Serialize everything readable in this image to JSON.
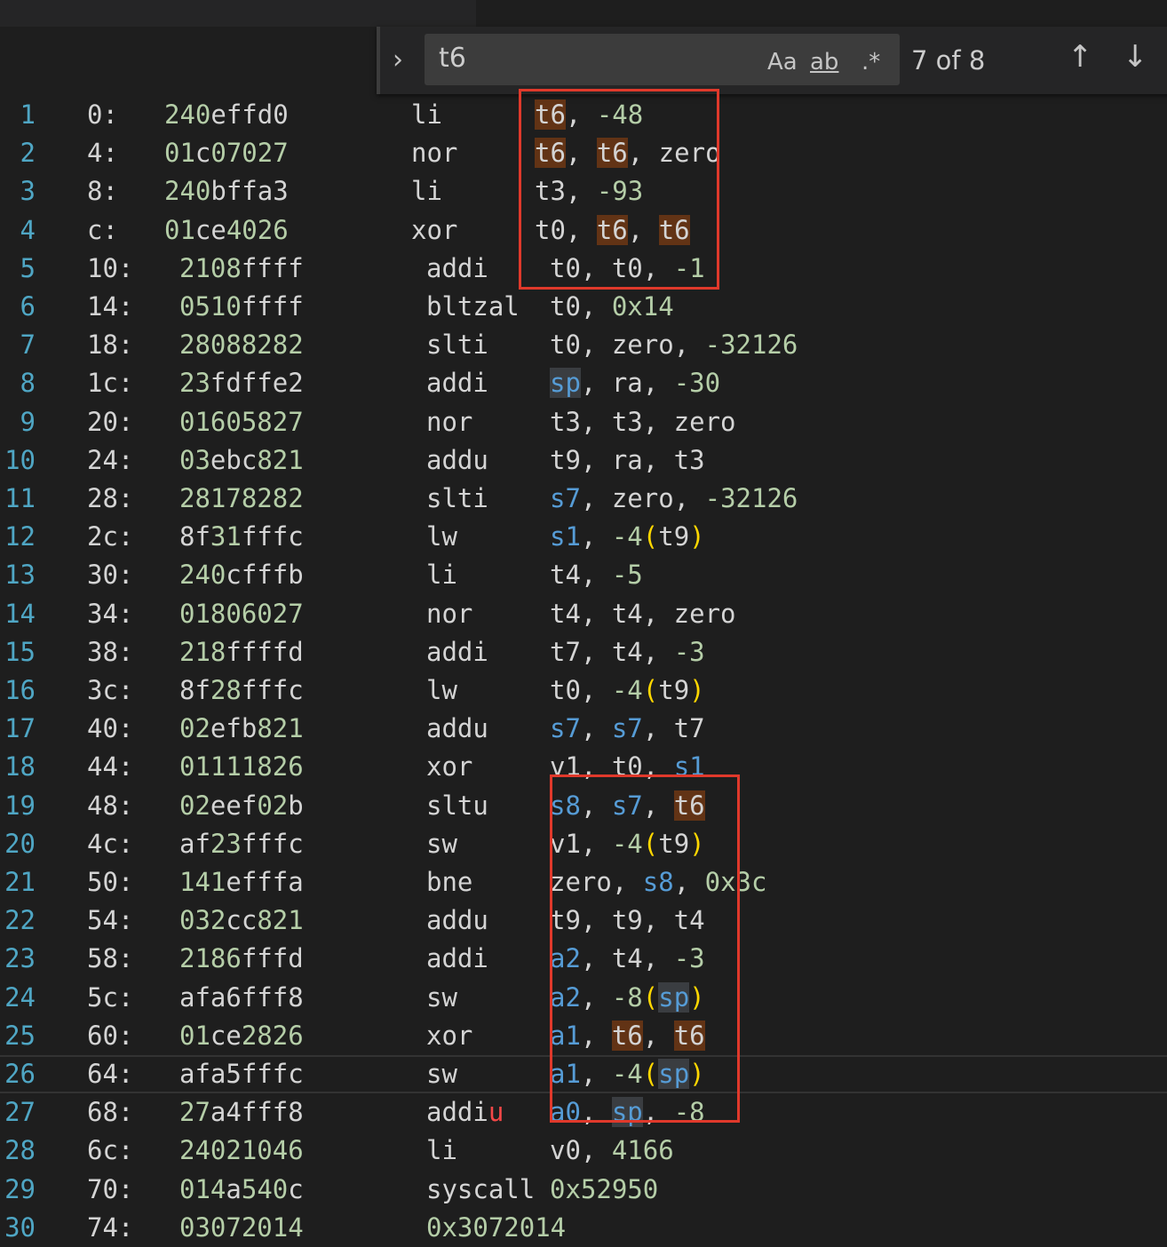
{
  "find": {
    "query": "t6",
    "match_case_label": "Aa",
    "whole_word_label": "ab",
    "regex_label": ".*",
    "result_count": "7 of 8"
  },
  "rows": [
    {
      "ln": "1",
      "off": "0:",
      "hex": "240effd0",
      "mn": "li",
      "ops": "t6, -48"
    },
    {
      "ln": "2",
      "off": "4:",
      "hex": "01c07027",
      "mn": "nor",
      "ops": "t6, t6, zero"
    },
    {
      "ln": "3",
      "off": "8:",
      "hex": "240bffa3",
      "mn": "li",
      "ops": "t3, -93"
    },
    {
      "ln": "4",
      "off": "c:",
      "hex": "01ce4026",
      "mn": "xor",
      "ops": "t0, t6, t6"
    },
    {
      "ln": "5",
      "off": "10:",
      "hex": "2108ffff",
      "mn": "addi",
      "ops": "t0, t0, -1"
    },
    {
      "ln": "6",
      "off": "14:",
      "hex": "0510ffff",
      "mn": "bltzal",
      "ops": "t0, 0x14"
    },
    {
      "ln": "7",
      "off": "18:",
      "hex": "28088282",
      "mn": "slti",
      "ops": "t0, zero, -32126"
    },
    {
      "ln": "8",
      "off": "1c:",
      "hex": "23fdffe2",
      "mn": "addi",
      "ops": "sp, ra, -30"
    },
    {
      "ln": "9",
      "off": "20:",
      "hex": "01605827",
      "mn": "nor",
      "ops": "t3, t3, zero"
    },
    {
      "ln": "10",
      "off": "24:",
      "hex": "03ebc821",
      "mn": "addu",
      "ops": "t9, ra, t3"
    },
    {
      "ln": "11",
      "off": "28:",
      "hex": "28178282",
      "mn": "slti",
      "ops": "s7, zero, -32126"
    },
    {
      "ln": "12",
      "off": "2c:",
      "hex": "8f31fffc",
      "mn": "lw",
      "ops": "s1, -4(t9)"
    },
    {
      "ln": "13",
      "off": "30:",
      "hex": "240cfffb",
      "mn": "li",
      "ops": "t4, -5"
    },
    {
      "ln": "14",
      "off": "34:",
      "hex": "01806027",
      "mn": "nor",
      "ops": "t4, t4, zero"
    },
    {
      "ln": "15",
      "off": "38:",
      "hex": "218ffffd",
      "mn": "addi",
      "ops": "t7, t4, -3"
    },
    {
      "ln": "16",
      "off": "3c:",
      "hex": "8f28fffc",
      "mn": "lw",
      "ops": "t0, -4(t9)"
    },
    {
      "ln": "17",
      "off": "40:",
      "hex": "02efb821",
      "mn": "addu",
      "ops": "s7, s7, t7"
    },
    {
      "ln": "18",
      "off": "44:",
      "hex": "01111826",
      "mn": "xor",
      "ops": "v1, t0, s1"
    },
    {
      "ln": "19",
      "off": "48:",
      "hex": "02eef02b",
      "mn": "sltu",
      "ops": "s8, s7, t6"
    },
    {
      "ln": "20",
      "off": "4c:",
      "hex": "af23fffc",
      "mn": "sw",
      "ops": "v1, -4(t9)"
    },
    {
      "ln": "21",
      "off": "50:",
      "hex": "141efffa",
      "mn": "bne",
      "ops": "zero, s8, 0x3c"
    },
    {
      "ln": "22",
      "off": "54:",
      "hex": "032cc821",
      "mn": "addu",
      "ops": "t9, t9, t4"
    },
    {
      "ln": "23",
      "off": "58:",
      "hex": "2186fffd",
      "mn": "addi",
      "ops": "a2, t4, -3"
    },
    {
      "ln": "24",
      "off": "5c:",
      "hex": "afa6fff8",
      "mn": "sw",
      "ops": "a2, -8(sp)"
    },
    {
      "ln": "25",
      "off": "60:",
      "hex": "01ce2826",
      "mn": "xor",
      "ops": "a1, t6, t6"
    },
    {
      "ln": "26",
      "off": "64:",
      "hex": "afa5fffc",
      "mn": "sw",
      "ops": "a1, -4(sp)"
    },
    {
      "ln": "27",
      "off": "68:",
      "hex": "27a4fff8",
      "mn": "addiu",
      "ops": "a0, sp, -8"
    },
    {
      "ln": "28",
      "off": "6c:",
      "hex": "24021046",
      "mn": "li",
      "ops": "v0, 4166"
    },
    {
      "ln": "29",
      "off": "70:",
      "hex": "014a540c",
      "mn": "syscall",
      "ops": "0x52950"
    },
    {
      "ln": "30",
      "off": "74:",
      "hex": "03072014",
      "mn": "",
      "ops": "0x3072014"
    }
  ],
  "colors": {
    "line_number": "#4fa6c4",
    "number_literal": "#b5cea8",
    "register": "#569cd6",
    "paren": "#ffd700",
    "search_match": "#623315",
    "annotation_box": "#e0392b"
  }
}
